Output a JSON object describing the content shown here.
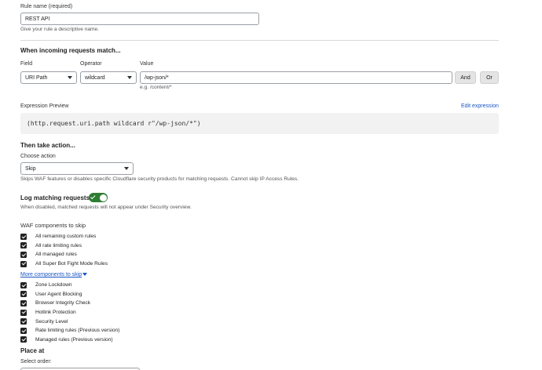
{
  "rule_name": {
    "label": "Rule name (required)",
    "value": "REST API",
    "help": "Give your rule a descriptive name."
  },
  "match": {
    "heading": "When incoming requests match...",
    "field_label": "Field",
    "operator_label": "Operator",
    "value_label": "Value",
    "field_value": "URI Path",
    "operator_value": "wildcard",
    "value_value": "/wp-json/*",
    "value_example": "e.g. /content/*",
    "and_label": "And",
    "or_label": "Or"
  },
  "expression": {
    "label": "Expression Preview",
    "edit_link": "Edit expression",
    "text": "(http.request.uri.path wildcard r\"/wp-json/*\")"
  },
  "action": {
    "heading": "Then take action...",
    "choose_label": "Choose action",
    "selected": "Skip",
    "help": "Skips WAF features or disables specific Cloudflare security products for matching requests. Cannot skip IP Access Rules."
  },
  "log": {
    "label": "Log matching requests",
    "enabled": true,
    "help": "When disabled, matched requests will not appear under Security overview."
  },
  "waf": {
    "heading": "WAF components to skip",
    "items": [
      {
        "label": "All remaining custom rules",
        "checked": true
      },
      {
        "label": "All rate limiting rules",
        "checked": true
      },
      {
        "label": "All managed rules",
        "checked": true
      },
      {
        "label": "All Super Bot Fight Mode Rules",
        "checked": true
      }
    ]
  },
  "more": {
    "link": "More components to skip",
    "items": [
      {
        "label": "Zone Lockdown",
        "checked": true
      },
      {
        "label": "User Agent Blocking",
        "checked": true
      },
      {
        "label": "Browser Integrity Check",
        "checked": true
      },
      {
        "label": "Hotlink Protection",
        "checked": true
      },
      {
        "label": "Security Level",
        "checked": true
      },
      {
        "label": "Rate limiting rules (Previous version)",
        "checked": true
      },
      {
        "label": "Managed rules (Previous version)",
        "checked": true
      }
    ]
  },
  "place": {
    "heading": "Place at",
    "select_label": "Select order:"
  },
  "colors": {
    "link": "#1a55c4",
    "toggle_on": "#2e7d32",
    "checkbox": "#222222"
  }
}
